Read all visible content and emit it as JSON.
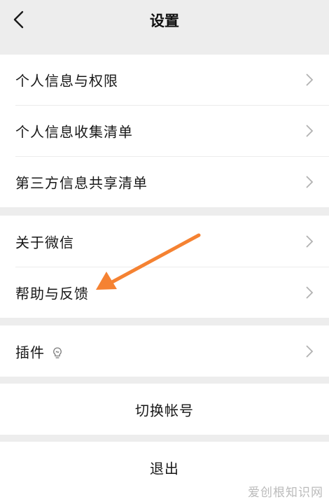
{
  "header": {
    "title": "设置",
    "back_icon": "chevron-left-icon"
  },
  "group_privacy": {
    "items": [
      {
        "label": "个人信息与权限"
      },
      {
        "label": "个人信息收集清单"
      },
      {
        "label": "第三方信息共享清单"
      }
    ]
  },
  "group_about": {
    "items": [
      {
        "label": "关于微信"
      },
      {
        "label": "帮助与反馈"
      }
    ]
  },
  "group_plugins": {
    "label": "插件",
    "icon": "lightbulb-icon"
  },
  "switch_account": {
    "label": "切换帐号"
  },
  "logout": {
    "label": "退出"
  },
  "annotation": {
    "arrow_color": "#f58232"
  },
  "watermark": {
    "text": "爱创根知识网"
  }
}
